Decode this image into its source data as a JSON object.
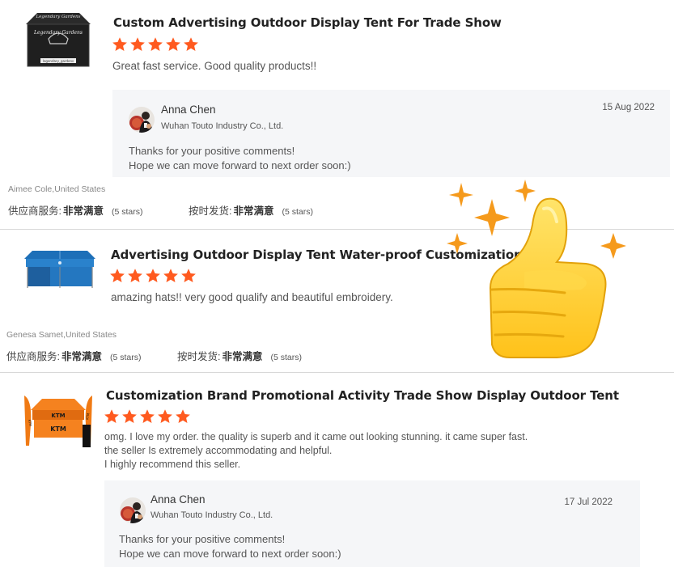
{
  "reviews": [
    {
      "title": "Custom Advertising Outdoor Display Tent For Trade Show",
      "stars": 5,
      "comment_lines": [
        "Great fast service. Good quality products!!"
      ],
      "thumb_text": [
        "Legendary Gardens",
        "Legendary Gardens",
        "legendary_gardens"
      ],
      "reply": {
        "name": "Anna Chen",
        "company": "Wuhan Touto Industry Co., Ltd.",
        "date": "15 Aug 2022",
        "lines": [
          "Thanks for your positive comments!",
          "Hope we can move forward to next order soon:)"
        ]
      },
      "reviewer": "Aimee Cole,United States",
      "ratings": [
        {
          "label": "供应商服务:",
          "value": "非常满意",
          "stars": "(5 stars)"
        },
        {
          "label": "按时发货:",
          "value": "非常满意",
          "stars": "(5 stars)"
        }
      ]
    },
    {
      "title": "Advertising Outdoor Display Tent Water-proof Customization",
      "stars": 5,
      "comment_lines": [
        "amazing hats!! very good qualify and beautiful embroidery."
      ],
      "reviewer": "Genesa Samet,United States",
      "ratings": [
        {
          "label": "供应商服务:",
          "value": "非常满意",
          "stars": "(5 stars)"
        },
        {
          "label": "按时发货:",
          "value": "非常满意",
          "stars": "(5 stars)"
        }
      ]
    },
    {
      "title": "Customization Brand Promotional Activity Trade Show Display Outdoor Tent",
      "stars": 5,
      "comment_lines": [
        "omg. I love my order. the quality is superb and it came out looking stunning. it came super fast.",
        "the seller Is extremely accommodating and helpful.",
        "I highly recommend this seller."
      ],
      "thumb_text": [
        "KTM",
        "KTM",
        "KTM",
        "KTM"
      ],
      "reply": {
        "name": "Anna Chen",
        "company": "Wuhan Touto Industry Co., Ltd.",
        "date": "17 Jul 2022",
        "lines": [
          "Thanks for your positive comments!",
          "Hope we can move forward to next order soon:)"
        ]
      }
    }
  ],
  "colors": {
    "star": "#ff5a1f",
    "reply_bg": "#f5f6f8",
    "thumb_yellow": "#ffd23a",
    "sparkle": "#f59a1c"
  },
  "icons": [
    "star-icon",
    "thumbs-up-icon",
    "sparkle-icon",
    "avatar"
  ]
}
